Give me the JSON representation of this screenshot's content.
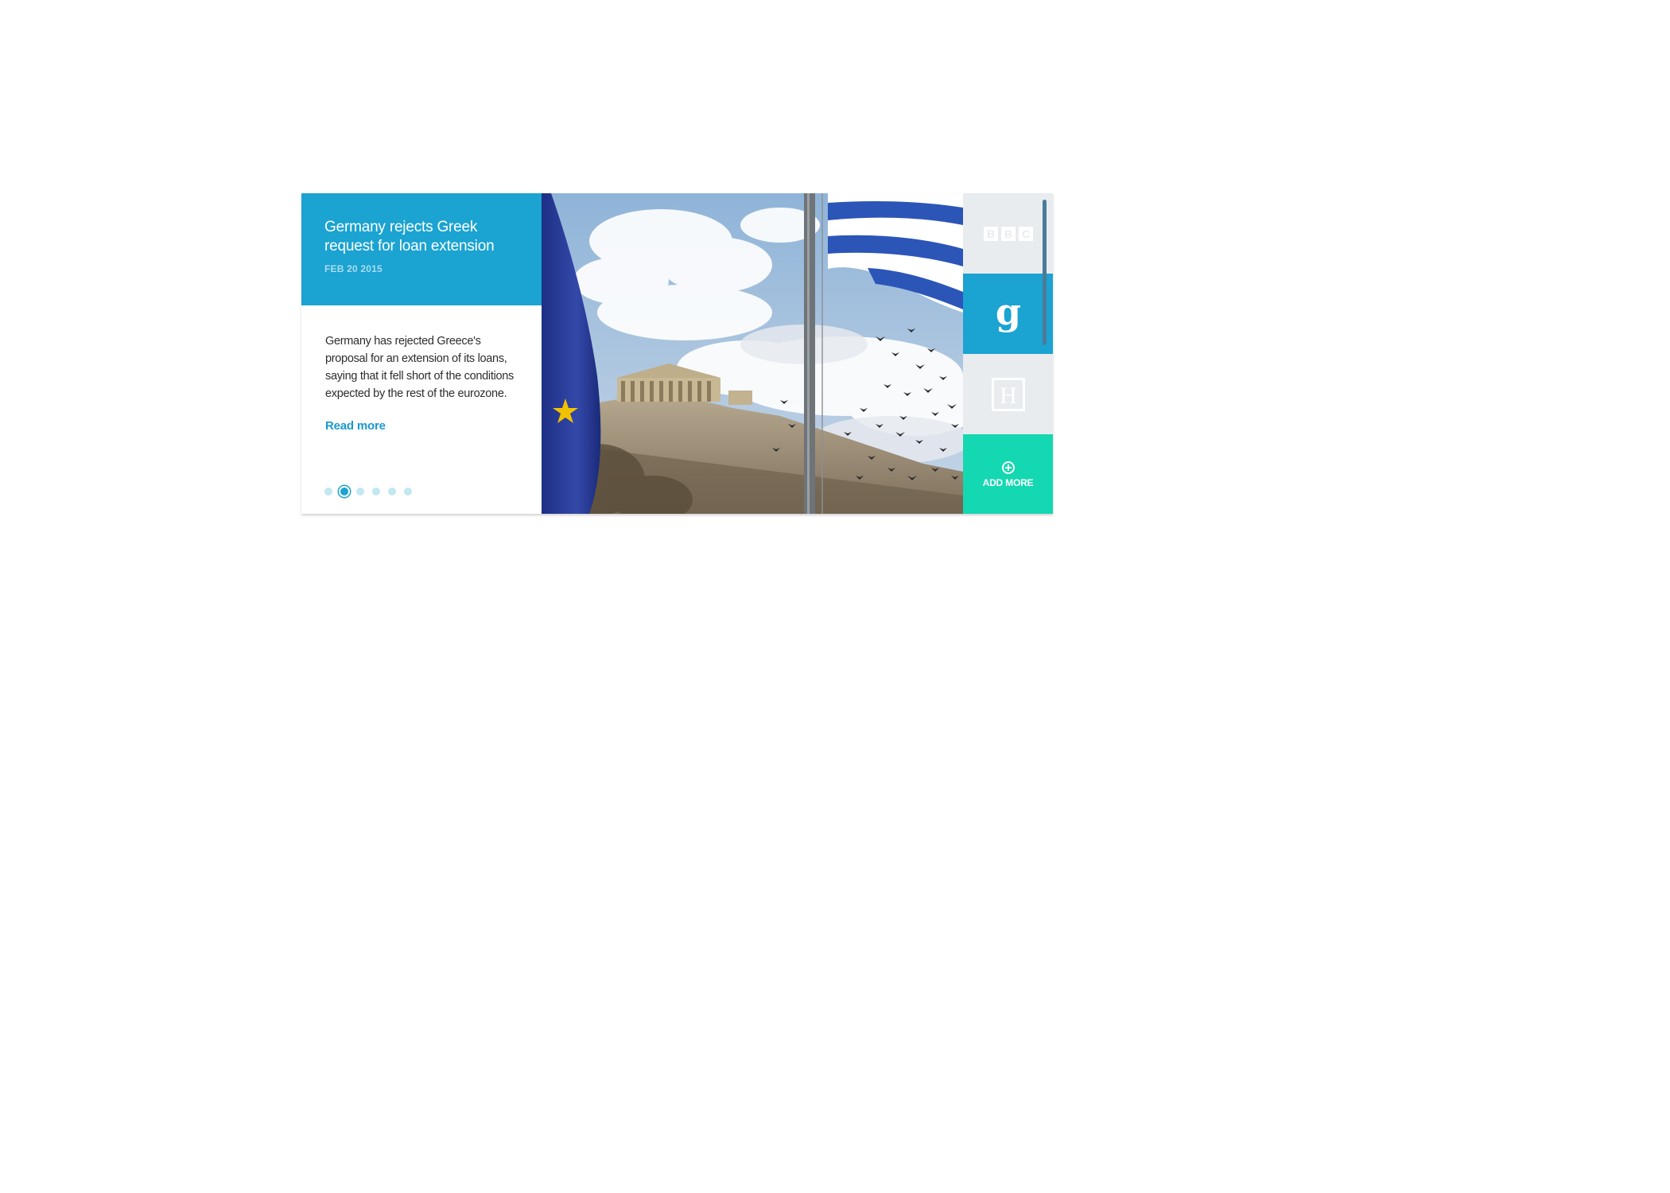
{
  "article": {
    "headline": "Germany rejects Greek request for loan extension",
    "date": "FEB 20 2015",
    "summary": "Germany has rejected Greece's proposal for an extension of its loans, saying that it fell short of the conditions expected by the rest of the eurozone.",
    "read_more": "Read more"
  },
  "pagination": {
    "total": 6,
    "active_index": 1
  },
  "photo": {
    "subject": "Acropolis with Greek and EU flags"
  },
  "sources": {
    "items": [
      {
        "name": "BBC",
        "logo": "bbc-logo",
        "selected": false
      },
      {
        "name": "Guardian",
        "logo": "g",
        "selected": true
      },
      {
        "name": "Huffington Post",
        "logo": "H",
        "selected": false
      }
    ],
    "add_more": "ADD MORE",
    "add_icon": "plus-circle-icon"
  },
  "colors": {
    "accent_blue": "#1ba3d1",
    "add_more_green": "#14d8b1",
    "source_grey": "#e8ecef"
  }
}
